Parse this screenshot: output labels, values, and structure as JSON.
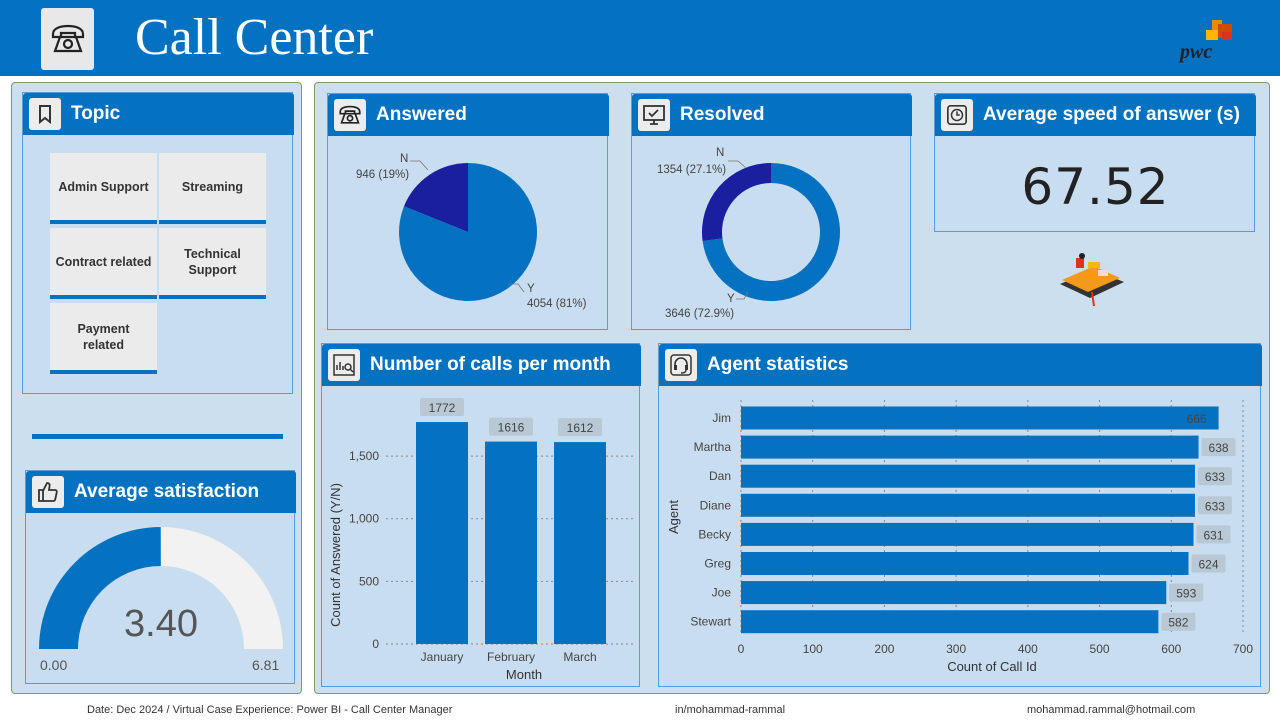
{
  "header": {
    "title": "Call Center",
    "logo_icon": "telephone-icon",
    "brand": "pwc"
  },
  "topic": {
    "title": "Topic",
    "icon": "bookmark-icon",
    "items": [
      "Admin Support",
      "Streaming",
      "Contract related",
      "Technical Support",
      "Payment related"
    ]
  },
  "satisfaction": {
    "title": "Average satisfaction",
    "icon": "thumbs-up-icon",
    "value": "3.40",
    "min": "0.00",
    "max": "6.81",
    "fraction": 0.4993
  },
  "answered": {
    "title": "Answered",
    "icon": "telephone-icon",
    "n_label": "N",
    "n_value": "946 (19%)",
    "y_label": "Y",
    "y_value": "4054 (81%)"
  },
  "resolved": {
    "title": "Resolved",
    "icon": "monitor-check-icon",
    "n_label": "N",
    "n_value": "1354 (27.1%)",
    "y_label": "Y",
    "y_value": "3646 (72.9%)"
  },
  "speed": {
    "title": "Average speed of answer (s)",
    "icon": "clock-icon",
    "value": "67.52"
  },
  "calls_chart": {
    "title": "Number of calls per month",
    "icon": "chart-search-icon"
  },
  "agents_chart": {
    "title": "Agent statistics",
    "icon": "headset-icon"
  },
  "footer": {
    "left": "Date: Dec 2024 / Virtual Case Experience: Power BI -  Call Center Manager",
    "middle": "in/mohammad-rammal",
    "right": "mohammad.rammal@hotmail.com"
  },
  "colors": {
    "primary": "#0572c1",
    "dark": "#1820a0",
    "panel": "#ccdfef"
  },
  "chart_data": [
    {
      "type": "pie",
      "categories": [
        "N",
        "Y"
      ],
      "values": [
        946,
        4054
      ],
      "labels": [
        "946 (19%)",
        "4054 (81%)"
      ]
    },
    {
      "type": "pie",
      "donut": true,
      "categories": [
        "N",
        "Y"
      ],
      "values": [
        1354,
        3646
      ],
      "labels": [
        "1354 (27.1%)",
        "3646 (72.9%)"
      ]
    },
    {
      "type": "bar",
      "categories": [
        "January",
        "February",
        "March"
      ],
      "values": [
        1772,
        1616,
        1612
      ],
      "xlabel": "Month",
      "ylabel": "Count of Answered (Y/N)",
      "yticks": [
        "0",
        "500",
        "1,000",
        "1,500"
      ],
      "ylim": [
        0,
        1900
      ],
      "grid": true
    },
    {
      "type": "bar",
      "orientation": "horizontal",
      "categories": [
        "Jim",
        "Martha",
        "Dan",
        "Diane",
        "Becky",
        "Greg",
        "Joe",
        "Stewart"
      ],
      "values": [
        666,
        638,
        633,
        633,
        631,
        624,
        593,
        582
      ],
      "xlabel": "Count of Call Id",
      "ylabel": "Agent",
      "xticks": [
        "0",
        "100",
        "200",
        "300",
        "400",
        "500",
        "600",
        "700"
      ],
      "xlim": [
        0,
        700
      ],
      "grid": true
    }
  ]
}
